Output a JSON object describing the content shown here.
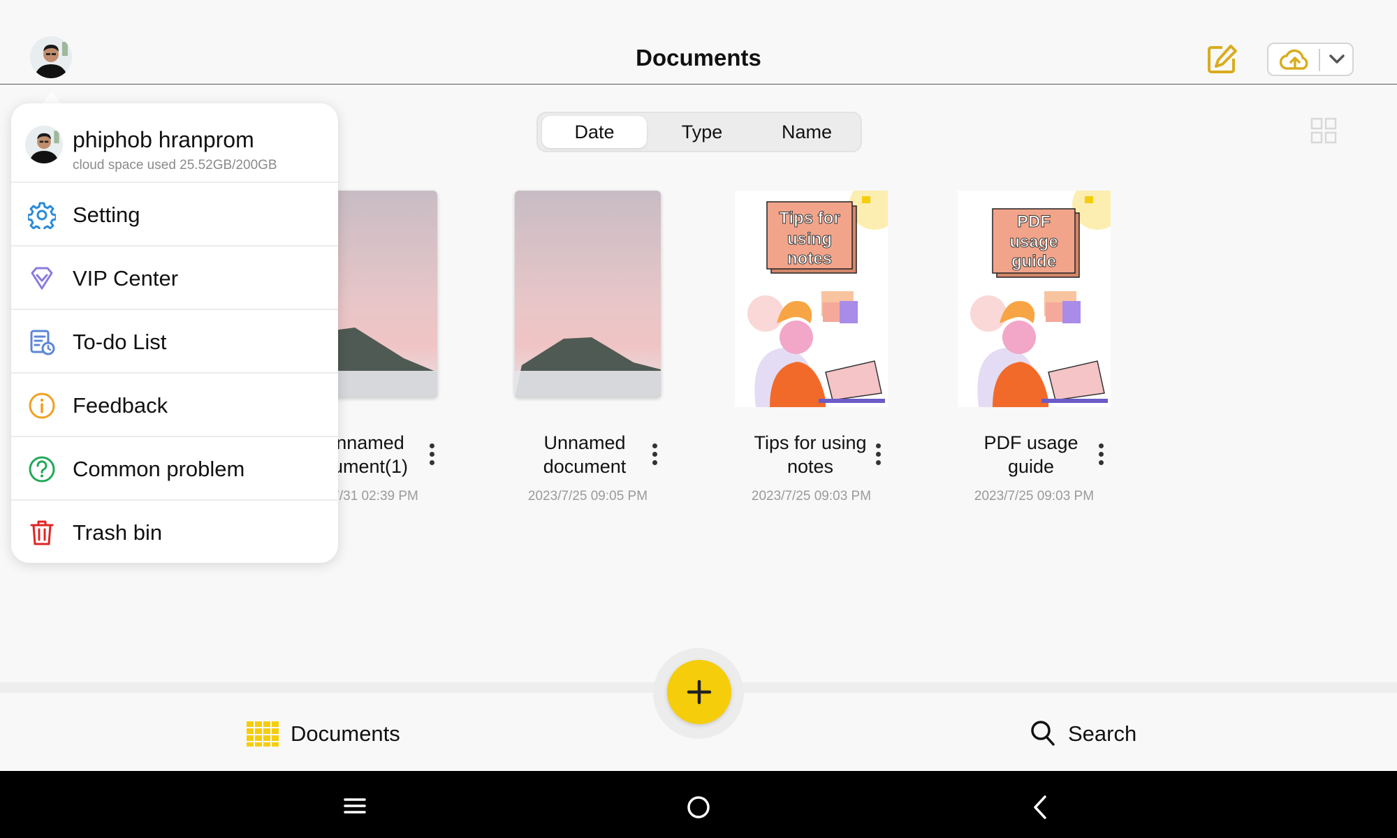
{
  "header": {
    "title": "Documents"
  },
  "sort": {
    "options": [
      "Date",
      "Type",
      "Name"
    ],
    "selected": "Date"
  },
  "documents": [
    {
      "title_line1": "nnamed",
      "title_line2": "ument(1)",
      "date": "/7/31 02:39 PM"
    },
    {
      "title_line1": "Unnamed",
      "title_line2": "document",
      "date": "2023/7/25 09:05 PM"
    },
    {
      "title_line1": "Tips for using",
      "title_line2": "notes",
      "date": "2023/7/25 09:03 PM",
      "cover_text": [
        "Tips for",
        "using",
        "notes"
      ]
    },
    {
      "title_line1": "PDF usage",
      "title_line2": "guide",
      "date": "2023/7/25 09:03 PM",
      "cover_text": [
        "PDF",
        "usage",
        "guide"
      ]
    }
  ],
  "menu": {
    "profile_name": "phiphob hranprom",
    "profile_sub": "cloud space used 25.52GB/200GB",
    "items": [
      {
        "label": "Setting",
        "icon": "gear-icon",
        "color": "#2a8bd8"
      },
      {
        "label": "VIP Center",
        "icon": "diamond-icon",
        "color": "#8a7be0"
      },
      {
        "label": "To-do List",
        "icon": "todo-list-icon",
        "color": "#5c86d6"
      },
      {
        "label": "Feedback",
        "icon": "info-icon",
        "color": "#f0a020"
      },
      {
        "label": "Common problem",
        "icon": "question-icon",
        "color": "#22a858"
      },
      {
        "label": "Trash bin",
        "icon": "trash-icon",
        "color": "#e02424"
      }
    ]
  },
  "bottom_nav": {
    "documents": "Documents",
    "search": "Search"
  },
  "colors": {
    "accent": "#f5cd0b",
    "edit_icon": "#d9ac1e"
  }
}
